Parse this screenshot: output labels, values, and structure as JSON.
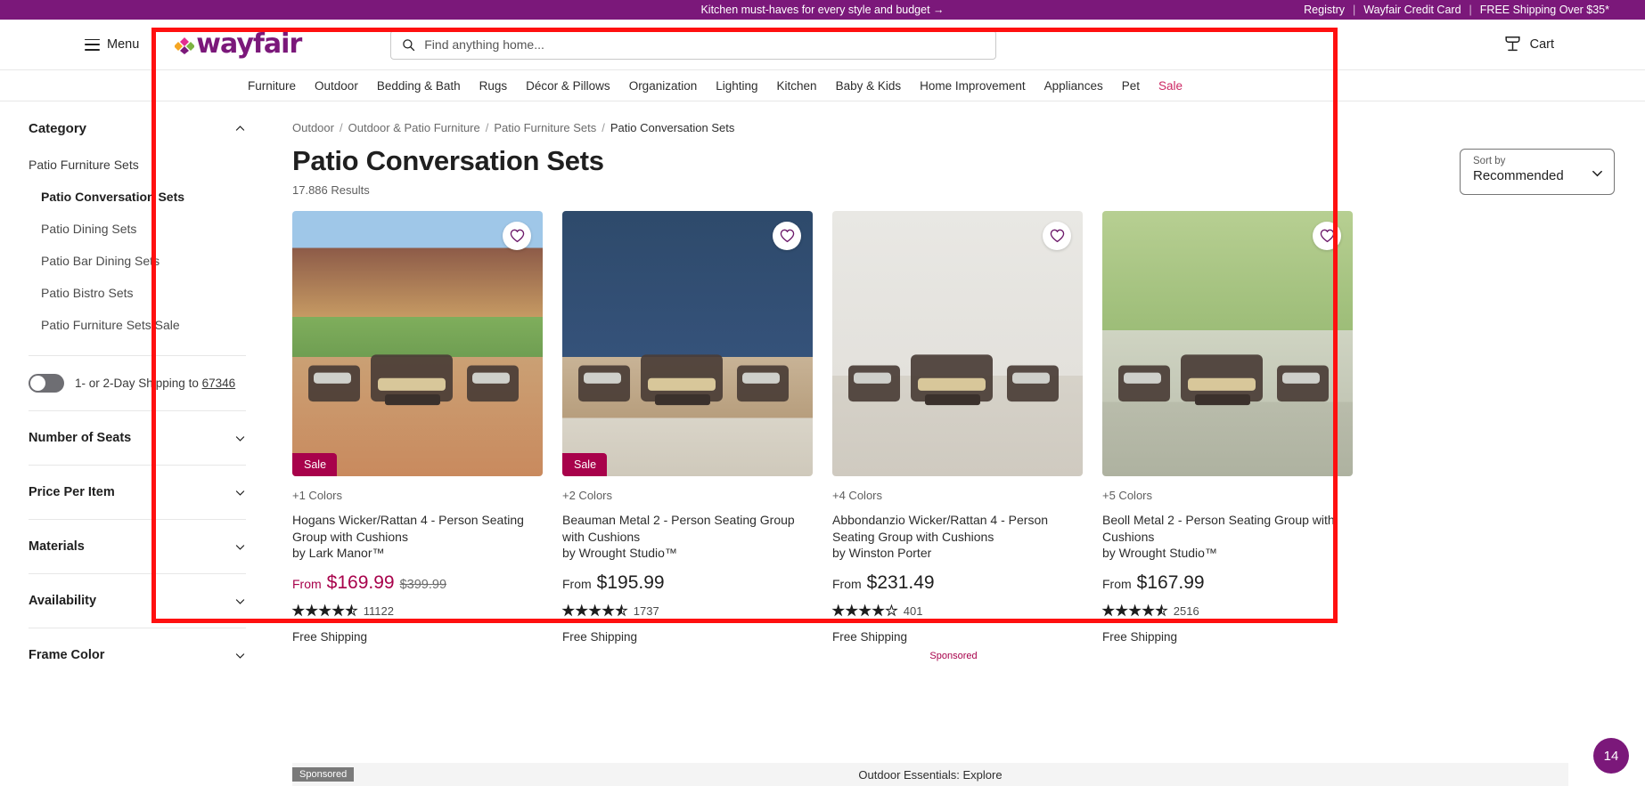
{
  "promo": {
    "left_message": "Kitchen must-haves for every style and budget →",
    "right_links": [
      "Registry",
      "Wayfair Credit Card",
      "FREE Shipping Over $35*"
    ]
  },
  "header": {
    "menu_label": "Menu",
    "logo_text": "wayfair",
    "search_placeholder": "Find anything home...",
    "search_value": "",
    "cart_label": "Cart"
  },
  "catnav": {
    "items": [
      {
        "label": "Furniture",
        "sale": false
      },
      {
        "label": "Outdoor",
        "sale": false
      },
      {
        "label": "Bedding & Bath",
        "sale": false
      },
      {
        "label": "Rugs",
        "sale": false
      },
      {
        "label": "Décor & Pillows",
        "sale": false
      },
      {
        "label": "Organization",
        "sale": false
      },
      {
        "label": "Lighting",
        "sale": false
      },
      {
        "label": "Kitchen",
        "sale": false
      },
      {
        "label": "Baby & Kids",
        "sale": false
      },
      {
        "label": "Home Improvement",
        "sale": false
      },
      {
        "label": "Appliances",
        "sale": false
      },
      {
        "label": "Pet",
        "sale": false
      },
      {
        "label": "Sale",
        "sale": true
      }
    ]
  },
  "sidebar": {
    "category_header": "Category",
    "categories": [
      {
        "label": "Patio Furniture Sets",
        "level": "root",
        "active": false
      },
      {
        "label": "Patio Conversation Sets",
        "level": "child",
        "active": true
      },
      {
        "label": "Patio Dining Sets",
        "level": "child",
        "active": false
      },
      {
        "label": "Patio Bar Dining Sets",
        "level": "child",
        "active": false
      },
      {
        "label": "Patio Bistro Sets",
        "level": "child",
        "active": false
      },
      {
        "label": "Patio Furniture Sets Sale",
        "level": "child",
        "active": false
      }
    ],
    "shipping_toggle": {
      "text_before": "1- or 2-Day Shipping to ",
      "zip": "67346",
      "on": false
    },
    "filters": [
      {
        "label": "Number of Seats"
      },
      {
        "label": "Price Per Item"
      },
      {
        "label": "Materials"
      },
      {
        "label": "Availability"
      },
      {
        "label": "Frame Color"
      }
    ]
  },
  "main": {
    "breadcrumb": [
      "Outdoor",
      "Outdoor & Patio Furniture",
      "Patio Furniture Sets",
      "Patio Conversation Sets"
    ],
    "page_title": "Patio Conversation Sets",
    "results": "17.886 Results",
    "sort": {
      "label": "Sort by",
      "value": "Recommended"
    },
    "sponsored_note": "Sponsored"
  },
  "products": [
    {
      "colors": "+1 Colors",
      "name": "Hogans Wicker/Rattan 4 - Person Seating Group with Cushions",
      "brand": "by Lark Manor™",
      "from_label": "From",
      "price": "$169.99",
      "was_price": "$399.99",
      "on_sale": true,
      "sale_badge": "Sale",
      "rating": 4.5,
      "review_count": "11122",
      "shipping": "Free Shipping"
    },
    {
      "colors": "+2 Colors",
      "name": "Beauman Metal 2 - Person Seating Group with Cushions",
      "brand": "by Wrought Studio™",
      "from_label": "From",
      "price": "$195.99",
      "was_price": "",
      "on_sale": true,
      "sale_badge": "Sale",
      "rating": 4.5,
      "review_count": "1737",
      "shipping": "Free Shipping"
    },
    {
      "colors": "+4 Colors",
      "name": "Abbondanzio Wicker/Rattan 4 - Person Seating Group with Cushions",
      "brand": "by Winston Porter",
      "from_label": "From",
      "price": "$231.49",
      "was_price": "",
      "on_sale": false,
      "sale_badge": "",
      "rating": 4.0,
      "review_count": "401",
      "shipping": "Free Shipping"
    },
    {
      "colors": "+5 Colors",
      "name": "Beoll Metal 2 - Person Seating Group with Cushions",
      "brand": "by Wrought Studio™",
      "from_label": "From",
      "price": "$167.99",
      "was_price": "",
      "on_sale": false,
      "sale_badge": "",
      "rating": 4.5,
      "review_count": "2516",
      "shipping": "Free Shipping"
    }
  ],
  "bottom_strip": {
    "sponsored_tag": "Sponsored",
    "title": "Outdoor Essentials: Explore"
  },
  "float_badge": {
    "count": "14"
  },
  "colors": {
    "brand_purple": "#7b187a",
    "sale_magenta": "#a8024b",
    "nav_sale": "#cc2763",
    "annotation_red": "#ff1010"
  }
}
